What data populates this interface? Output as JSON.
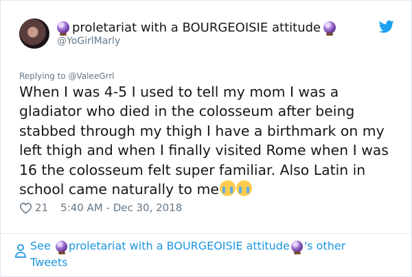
{
  "header": {
    "display_name": "proletariat with a BOURGEOISIE attitude",
    "handle": "@YoGirlMarly",
    "avatar_icon": "user-avatar",
    "decoration_icon": "crystal-ball-emoji",
    "platform_icon": "twitter-bird-icon"
  },
  "tweet": {
    "reply_to": "Replying to @ValeeGrrl",
    "text": "When I was 4-5 I used to tell my mom I was a\ngladiator who died in the colosseum after being\nstabbed through my thigh I have a birthmark on my\nleft thigh and when I finally visited Rome when I was\n16 the colosseum felt super familiar. Also Latin in\nschool came naturally to me",
    "trailing_emoji": "loudly-crying-face-emoji",
    "likes": "21",
    "timestamp": "5:40 AM - Dec 30, 2018"
  },
  "footer": {
    "see_prefix": "See",
    "name": "proletariat with a BOURGEOISIE attitude",
    "suffix_1": "'s other",
    "suffix_2": "Tweets"
  },
  "colors": {
    "text": "#14171a",
    "secondary": "#657786",
    "link": "#1b95e0",
    "twitter_blue": "#1da1f2",
    "border": "#e1e8ed"
  }
}
